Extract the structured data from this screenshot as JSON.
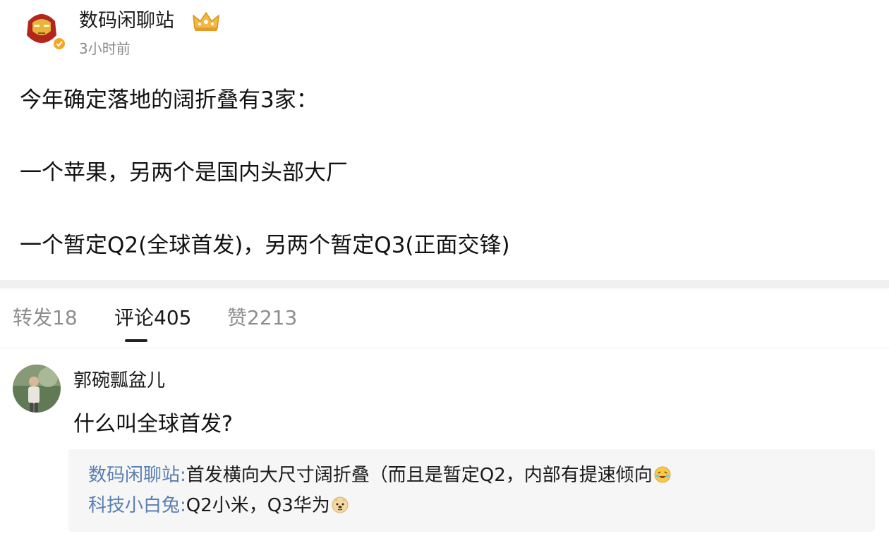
{
  "post": {
    "author": "数码闲聊站",
    "time": "3小时前",
    "lines": [
      "今年确定落地的阔折叠有3家：",
      "一个苹果，另两个是国内头部大厂",
      "一个暂定Q2(全球首发)，另两个暂定Q3(正面交锋)"
    ]
  },
  "tabs": {
    "repost": "转发18",
    "comments": "评论405",
    "likes": "赞2213",
    "active": "comments"
  },
  "comment": {
    "author": "郭碗瓢盆儿",
    "text": "什么叫全球首发?",
    "replies": [
      {
        "author": "数码闲聊站:",
        "text": "首发横向大尺寸阔折叠（而且是暂定Q2，内部有提速倾向",
        "emoji": "lol-emoji"
      },
      {
        "author": "科技小白兔:",
        "text": "Q2小米，Q3华为",
        "emoji": "doge-emoji"
      }
    ]
  },
  "colors": {
    "reply_author": "#5a7fb0",
    "muted_text": "#8d8d8d",
    "reply_background": "#f6f6f6"
  }
}
